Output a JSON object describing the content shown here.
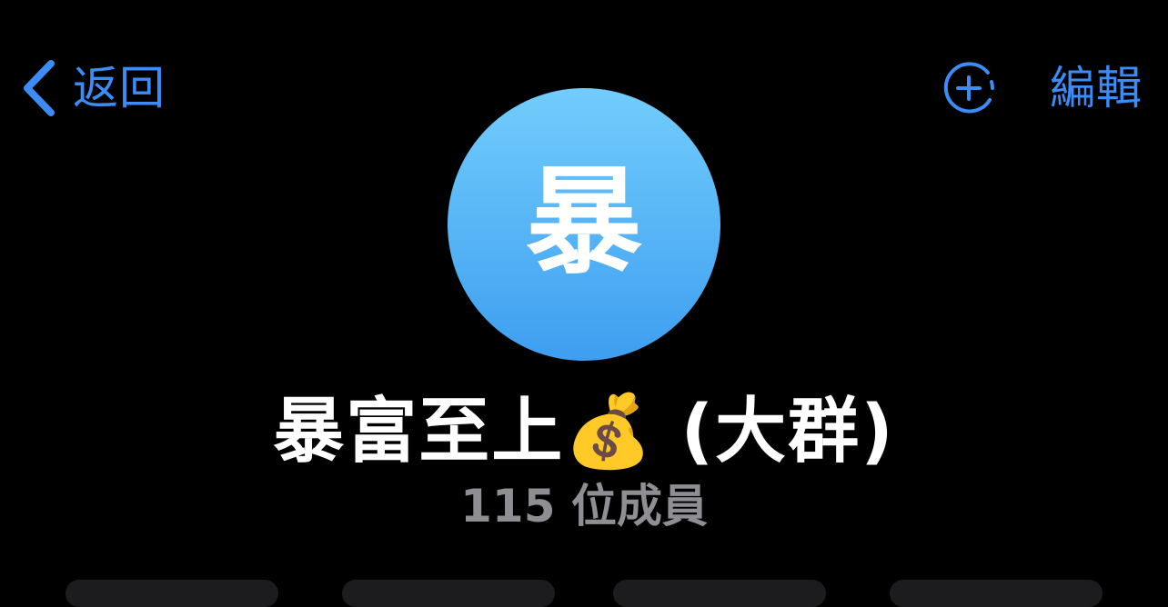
{
  "nav": {
    "back_label": "返回",
    "edit_label": "編輯",
    "back_icon": "chevron-left-icon",
    "add_member_icon": "circle-plus-dashed-icon"
  },
  "group": {
    "avatar_letter": "暴",
    "title": "暴富至上💰 (大群)",
    "member_count": "115 位成員"
  },
  "colors": {
    "accent": "#3b8cf6",
    "background": "#000000",
    "avatar_gradient_top": "#72cdfc",
    "avatar_gradient_bottom": "#3e9ef0",
    "secondary_text": "#8e8e93"
  }
}
